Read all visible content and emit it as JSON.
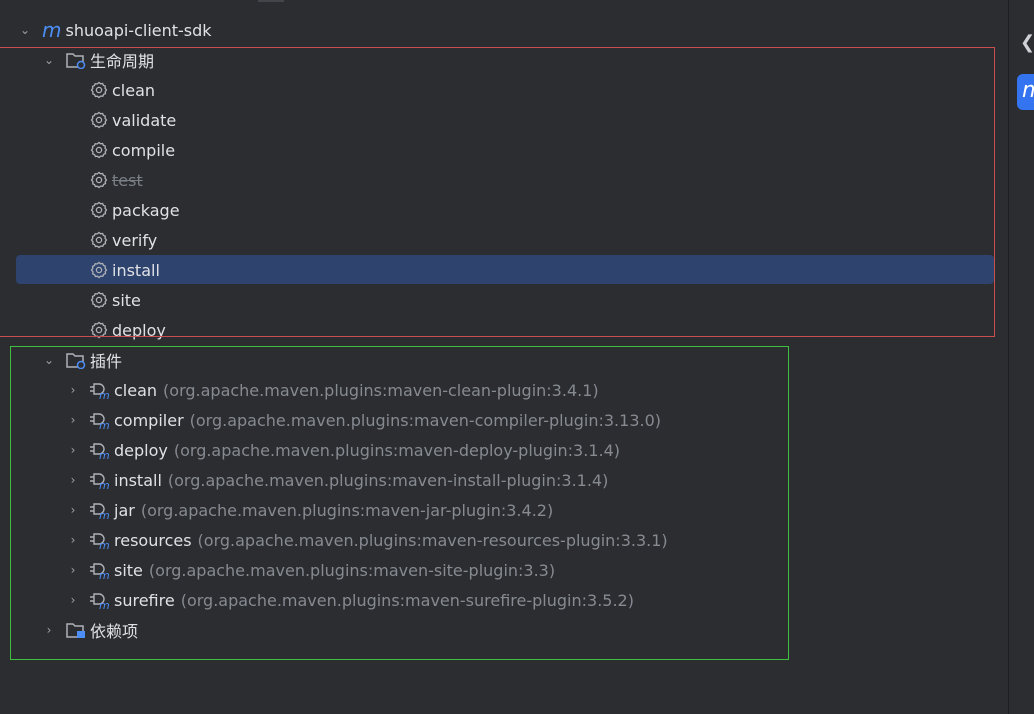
{
  "project": {
    "name": "shuoapi-client-sdk",
    "icon": "maven-m-icon"
  },
  "lifecycle": {
    "label": "生命周期",
    "items": [
      {
        "label": "clean"
      },
      {
        "label": "validate"
      },
      {
        "label": "compile"
      },
      {
        "label": "test",
        "skipped": true
      },
      {
        "label": "package"
      },
      {
        "label": "verify"
      },
      {
        "label": "install",
        "selected": true
      },
      {
        "label": "site"
      },
      {
        "label": "deploy"
      }
    ]
  },
  "plugins": {
    "label": "插件",
    "items": [
      {
        "label": "clean",
        "coord": "(org.apache.maven.plugins:maven-clean-plugin:3.4.1)"
      },
      {
        "label": "compiler",
        "coord": "(org.apache.maven.plugins:maven-compiler-plugin:3.13.0)"
      },
      {
        "label": "deploy",
        "coord": "(org.apache.maven.plugins:maven-deploy-plugin:3.1.4)"
      },
      {
        "label": "install",
        "coord": "(org.apache.maven.plugins:maven-install-plugin:3.1.4)"
      },
      {
        "label": "jar",
        "coord": "(org.apache.maven.plugins:maven-jar-plugin:3.4.2)"
      },
      {
        "label": "resources",
        "coord": "(org.apache.maven.plugins:maven-resources-plugin:3.3.1)"
      },
      {
        "label": "site",
        "coord": "(org.apache.maven.plugins:maven-site-plugin:3.3)"
      },
      {
        "label": "surefire",
        "coord": "(org.apache.maven.plugins:maven-surefire-plugin:3.5.2)"
      }
    ]
  },
  "dependencies": {
    "label": "依赖项"
  },
  "toolbar": {
    "maven_badge": "m",
    "back_icon": "chevron-left-icon"
  },
  "colors": {
    "selection": "#2e436e",
    "accent": "#3574f0",
    "highlight_red": "#c94f4f",
    "highlight_green": "#3fbf3f"
  }
}
